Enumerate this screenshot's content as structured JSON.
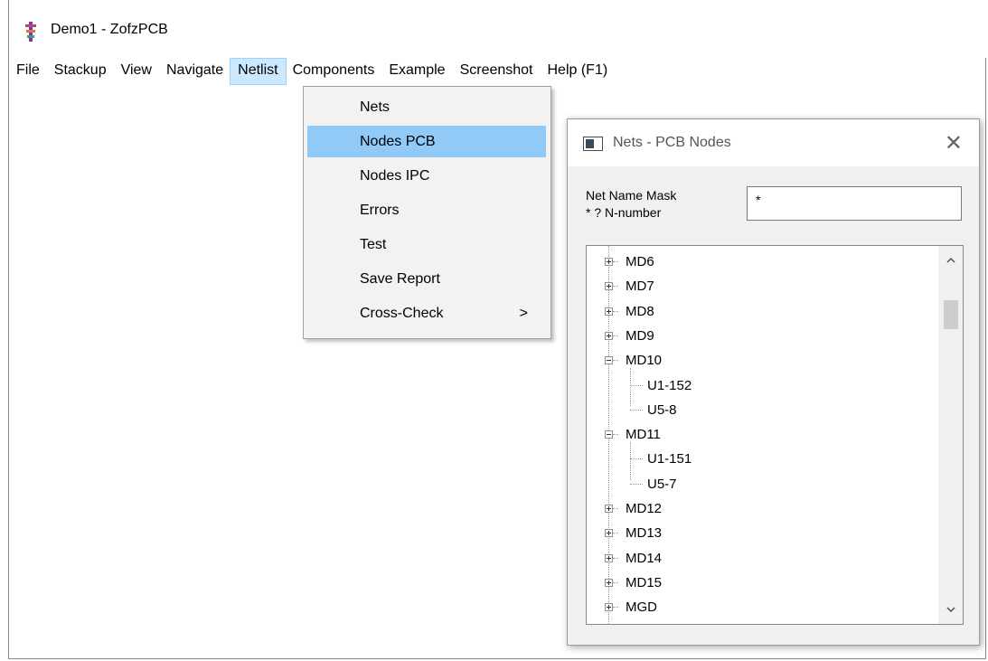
{
  "window": {
    "title": "Demo1 - ZofzPCB"
  },
  "menubar": {
    "items": [
      {
        "label": "File"
      },
      {
        "label": "Stackup"
      },
      {
        "label": "View"
      },
      {
        "label": "Navigate"
      },
      {
        "label": "Netlist",
        "active": true
      },
      {
        "label": "Components"
      },
      {
        "label": "Example"
      },
      {
        "label": "Screenshot"
      },
      {
        "label": "Help (F1)"
      }
    ]
  },
  "netlist_menu": {
    "items": [
      {
        "label": "Nets"
      },
      {
        "label": "Nodes PCB",
        "highlighted": true
      },
      {
        "label": "Nodes IPC"
      },
      {
        "label": "Errors"
      },
      {
        "label": "Test"
      },
      {
        "label": "Save Report"
      },
      {
        "label": "Cross-Check",
        "submenu_arrow": ">"
      }
    ]
  },
  "dialog": {
    "title": "Nets - PCB Nodes",
    "close_glyph": "✕",
    "mask_label_line1": "Net Name Mask",
    "mask_label_line2": "* ? N-number",
    "mask_value": "*",
    "tree": [
      {
        "label": "MD6",
        "expanded": false
      },
      {
        "label": "MD7",
        "expanded": false
      },
      {
        "label": "MD8",
        "expanded": false
      },
      {
        "label": "MD9",
        "expanded": false
      },
      {
        "label": "MD10",
        "expanded": true,
        "children": [
          "U1-152",
          "U5-8"
        ]
      },
      {
        "label": "MD11",
        "expanded": true,
        "children": [
          "U1-151",
          "U5-7"
        ]
      },
      {
        "label": "MD12",
        "expanded": false
      },
      {
        "label": "MD13",
        "expanded": false
      },
      {
        "label": "MD14",
        "expanded": false
      },
      {
        "label": "MD15",
        "expanded": false
      },
      {
        "label": "MGD",
        "expanded": false
      }
    ],
    "scroll_up_glyph": "^",
    "scroll_down_glyph": "v"
  }
}
